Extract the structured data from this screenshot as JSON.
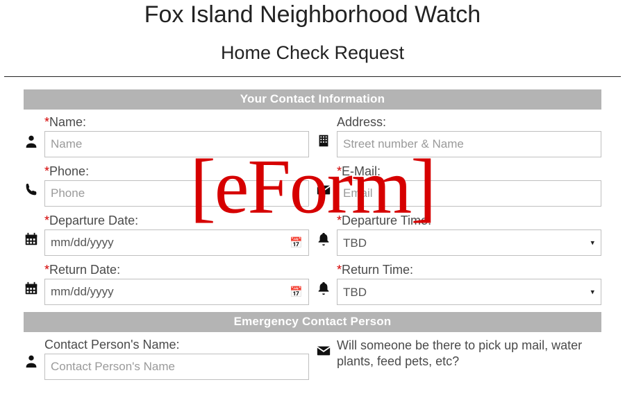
{
  "header": {
    "title": "Fox Island Neighborhood Watch",
    "subtitle": "Home Check Request"
  },
  "watermark": "[eForm]",
  "sections": {
    "contact": {
      "title": "Your Contact Information"
    },
    "emergency": {
      "title": "Emergency Contact Person"
    }
  },
  "fields": {
    "name": {
      "label": "Name:",
      "required": true,
      "placeholder": "Name"
    },
    "address": {
      "label": "Address:",
      "required": false,
      "placeholder": "Street number & Name"
    },
    "phone": {
      "label": "Phone:",
      "required": true,
      "placeholder": "Phone"
    },
    "email": {
      "label": "E-Mail:",
      "required": true,
      "placeholder": "Email"
    },
    "depDate": {
      "label": "Departure Date:",
      "required": true,
      "value": "mm/dd/yyyy"
    },
    "depTime": {
      "label": "Departure Time:",
      "required": true,
      "value": "TBD"
    },
    "retDate": {
      "label": "Return Date:",
      "required": true,
      "value": "mm/dd/yyyy"
    },
    "retTime": {
      "label": "Return Time:",
      "required": true,
      "value": "TBD"
    },
    "contactName": {
      "label": "Contact Person's Name:",
      "required": false,
      "placeholder": "Contact Person's Name"
    },
    "helper": "Will someone be there to pick up mail, water plants, feed pets, etc?"
  }
}
